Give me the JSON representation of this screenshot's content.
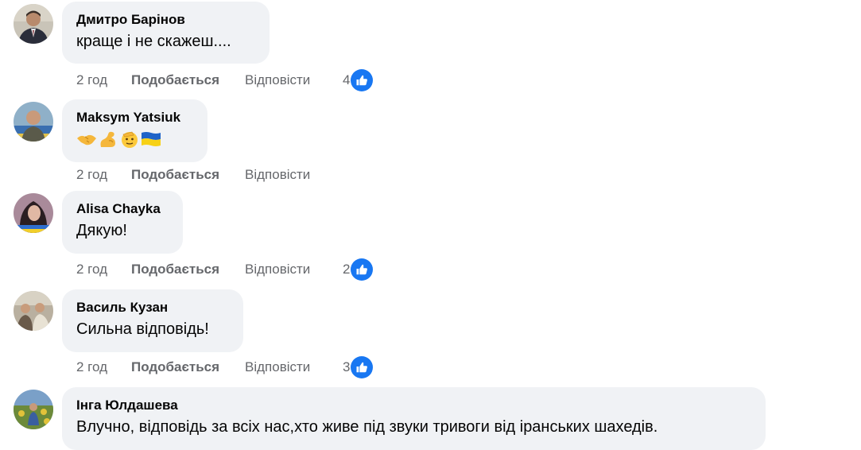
{
  "comments": [
    {
      "author": "Дмитро Барінов",
      "text": "краще і не скажеш....",
      "time": "2 год",
      "like_label": "Подобається",
      "reply_label": "Відповісти",
      "reactions": "4"
    },
    {
      "author": "Maksym Yatsiuk",
      "emojis": [
        "handshake-emoji",
        "flexed-biceps-emoji",
        "saluting-face-emoji",
        "ukraine-flag-emoji"
      ],
      "time": "2 год",
      "like_label": "Подобається",
      "reply_label": "Відповісти"
    },
    {
      "author": "Alisa Chayka",
      "text": "Дякую!",
      "time": "2 год",
      "like_label": "Подобається",
      "reply_label": "Відповісти",
      "reactions": "2"
    },
    {
      "author": "Василь Кузан",
      "text": "Сильна відповідь!",
      "time": "2 год",
      "like_label": "Подобається",
      "reply_label": "Відповісти",
      "reactions": "3"
    },
    {
      "author": "Інга Юлдашева",
      "text": "Влучно, відповідь за всіх нас,хто живе під звуки тривоги від іранських шахедів."
    }
  ],
  "colors": {
    "bubble": "#f0f2f5",
    "meta_text": "#65676b",
    "like_blue": "#1877f2"
  }
}
